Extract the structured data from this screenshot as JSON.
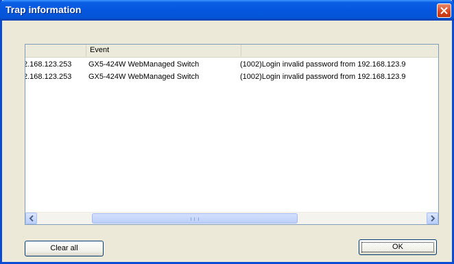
{
  "window": {
    "title": "Trap information",
    "close_icon": "close-icon"
  },
  "list": {
    "columns": [
      "",
      "Event",
      ""
    ],
    "rows": [
      {
        "source": "2.168.123.253",
        "device": "GX5-424W WebManaged Switch",
        "message": "(1002)Login invalid password from 192.168.123.9"
      },
      {
        "source": "2.168.123.253",
        "device": "GX5-424W WebManaged Switch",
        "message": "(1002)Login invalid password from 192.168.123.9"
      }
    ]
  },
  "scrollbar": {
    "left_icon": "chevron-left-icon",
    "right_icon": "chevron-right-icon"
  },
  "buttons": {
    "clear_all": "Clear all",
    "ok": "OK"
  }
}
